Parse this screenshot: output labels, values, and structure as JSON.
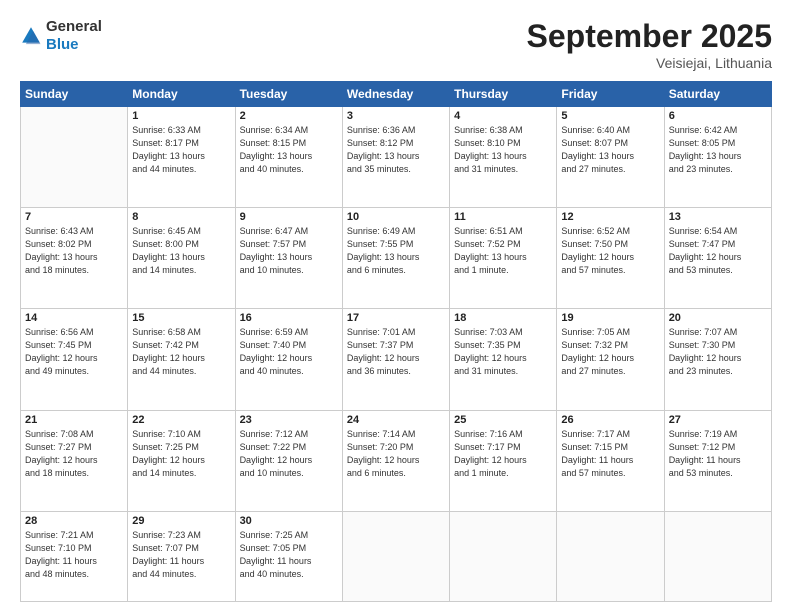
{
  "header": {
    "logo": {
      "general": "General",
      "blue": "Blue"
    },
    "title": "September 2025",
    "location": "Veisiejai, Lithuania"
  },
  "weekdays": [
    "Sunday",
    "Monday",
    "Tuesday",
    "Wednesday",
    "Thursday",
    "Friday",
    "Saturday"
  ],
  "weeks": [
    [
      {
        "day": "",
        "info": ""
      },
      {
        "day": "1",
        "info": "Sunrise: 6:33 AM\nSunset: 8:17 PM\nDaylight: 13 hours\nand 44 minutes."
      },
      {
        "day": "2",
        "info": "Sunrise: 6:34 AM\nSunset: 8:15 PM\nDaylight: 13 hours\nand 40 minutes."
      },
      {
        "day": "3",
        "info": "Sunrise: 6:36 AM\nSunset: 8:12 PM\nDaylight: 13 hours\nand 35 minutes."
      },
      {
        "day": "4",
        "info": "Sunrise: 6:38 AM\nSunset: 8:10 PM\nDaylight: 13 hours\nand 31 minutes."
      },
      {
        "day": "5",
        "info": "Sunrise: 6:40 AM\nSunset: 8:07 PM\nDaylight: 13 hours\nand 27 minutes."
      },
      {
        "day": "6",
        "info": "Sunrise: 6:42 AM\nSunset: 8:05 PM\nDaylight: 13 hours\nand 23 minutes."
      }
    ],
    [
      {
        "day": "7",
        "info": "Sunrise: 6:43 AM\nSunset: 8:02 PM\nDaylight: 13 hours\nand 18 minutes."
      },
      {
        "day": "8",
        "info": "Sunrise: 6:45 AM\nSunset: 8:00 PM\nDaylight: 13 hours\nand 14 minutes."
      },
      {
        "day": "9",
        "info": "Sunrise: 6:47 AM\nSunset: 7:57 PM\nDaylight: 13 hours\nand 10 minutes."
      },
      {
        "day": "10",
        "info": "Sunrise: 6:49 AM\nSunset: 7:55 PM\nDaylight: 13 hours\nand 6 minutes."
      },
      {
        "day": "11",
        "info": "Sunrise: 6:51 AM\nSunset: 7:52 PM\nDaylight: 13 hours\nand 1 minute."
      },
      {
        "day": "12",
        "info": "Sunrise: 6:52 AM\nSunset: 7:50 PM\nDaylight: 12 hours\nand 57 minutes."
      },
      {
        "day": "13",
        "info": "Sunrise: 6:54 AM\nSunset: 7:47 PM\nDaylight: 12 hours\nand 53 minutes."
      }
    ],
    [
      {
        "day": "14",
        "info": "Sunrise: 6:56 AM\nSunset: 7:45 PM\nDaylight: 12 hours\nand 49 minutes."
      },
      {
        "day": "15",
        "info": "Sunrise: 6:58 AM\nSunset: 7:42 PM\nDaylight: 12 hours\nand 44 minutes."
      },
      {
        "day": "16",
        "info": "Sunrise: 6:59 AM\nSunset: 7:40 PM\nDaylight: 12 hours\nand 40 minutes."
      },
      {
        "day": "17",
        "info": "Sunrise: 7:01 AM\nSunset: 7:37 PM\nDaylight: 12 hours\nand 36 minutes."
      },
      {
        "day": "18",
        "info": "Sunrise: 7:03 AM\nSunset: 7:35 PM\nDaylight: 12 hours\nand 31 minutes."
      },
      {
        "day": "19",
        "info": "Sunrise: 7:05 AM\nSunset: 7:32 PM\nDaylight: 12 hours\nand 27 minutes."
      },
      {
        "day": "20",
        "info": "Sunrise: 7:07 AM\nSunset: 7:30 PM\nDaylight: 12 hours\nand 23 minutes."
      }
    ],
    [
      {
        "day": "21",
        "info": "Sunrise: 7:08 AM\nSunset: 7:27 PM\nDaylight: 12 hours\nand 18 minutes."
      },
      {
        "day": "22",
        "info": "Sunrise: 7:10 AM\nSunset: 7:25 PM\nDaylight: 12 hours\nand 14 minutes."
      },
      {
        "day": "23",
        "info": "Sunrise: 7:12 AM\nSunset: 7:22 PM\nDaylight: 12 hours\nand 10 minutes."
      },
      {
        "day": "24",
        "info": "Sunrise: 7:14 AM\nSunset: 7:20 PM\nDaylight: 12 hours\nand 6 minutes."
      },
      {
        "day": "25",
        "info": "Sunrise: 7:16 AM\nSunset: 7:17 PM\nDaylight: 12 hours\nand 1 minute."
      },
      {
        "day": "26",
        "info": "Sunrise: 7:17 AM\nSunset: 7:15 PM\nDaylight: 11 hours\nand 57 minutes."
      },
      {
        "day": "27",
        "info": "Sunrise: 7:19 AM\nSunset: 7:12 PM\nDaylight: 11 hours\nand 53 minutes."
      }
    ],
    [
      {
        "day": "28",
        "info": "Sunrise: 7:21 AM\nSunset: 7:10 PM\nDaylight: 11 hours\nand 48 minutes."
      },
      {
        "day": "29",
        "info": "Sunrise: 7:23 AM\nSunset: 7:07 PM\nDaylight: 11 hours\nand 44 minutes."
      },
      {
        "day": "30",
        "info": "Sunrise: 7:25 AM\nSunset: 7:05 PM\nDaylight: 11 hours\nand 40 minutes."
      },
      {
        "day": "",
        "info": ""
      },
      {
        "day": "",
        "info": ""
      },
      {
        "day": "",
        "info": ""
      },
      {
        "day": "",
        "info": ""
      }
    ]
  ]
}
